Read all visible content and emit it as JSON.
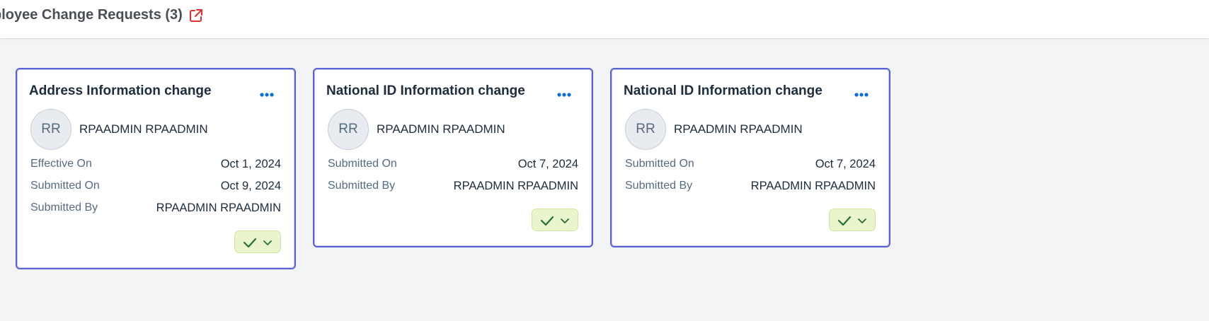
{
  "header": {
    "title": "ployee Change Requests (3)",
    "icon": "external-link-icon",
    "icon_color": "#e0302e"
  },
  "colors": {
    "card_border": "#5a61d6",
    "accent": "#0a6ed1",
    "approve_bg": "#ebf5cb",
    "approve_icon": "#256f3a"
  },
  "cards": [
    {
      "title": "Address Information change",
      "avatar_initials": "RR",
      "name": "RPAADMIN RPAADMIN",
      "fields": [
        {
          "label": "Effective On",
          "value": "Oct 1, 2024"
        },
        {
          "label": "Submitted On",
          "value": "Oct 9, 2024"
        },
        {
          "label": "Submitted By",
          "value": "RPAADMIN RPAADMIN"
        }
      ]
    },
    {
      "title": "National ID Information change",
      "avatar_initials": "RR",
      "name": "RPAADMIN RPAADMIN",
      "fields": [
        {
          "label": "Submitted On",
          "value": "Oct 7, 2024"
        },
        {
          "label": "Submitted By",
          "value": "RPAADMIN RPAADMIN"
        }
      ]
    },
    {
      "title": "National ID Information change",
      "avatar_initials": "RR",
      "name": "RPAADMIN RPAADMIN",
      "fields": [
        {
          "label": "Submitted On",
          "value": "Oct 7, 2024"
        },
        {
          "label": "Submitted By",
          "value": "RPAADMIN RPAADMIN"
        }
      ]
    }
  ]
}
